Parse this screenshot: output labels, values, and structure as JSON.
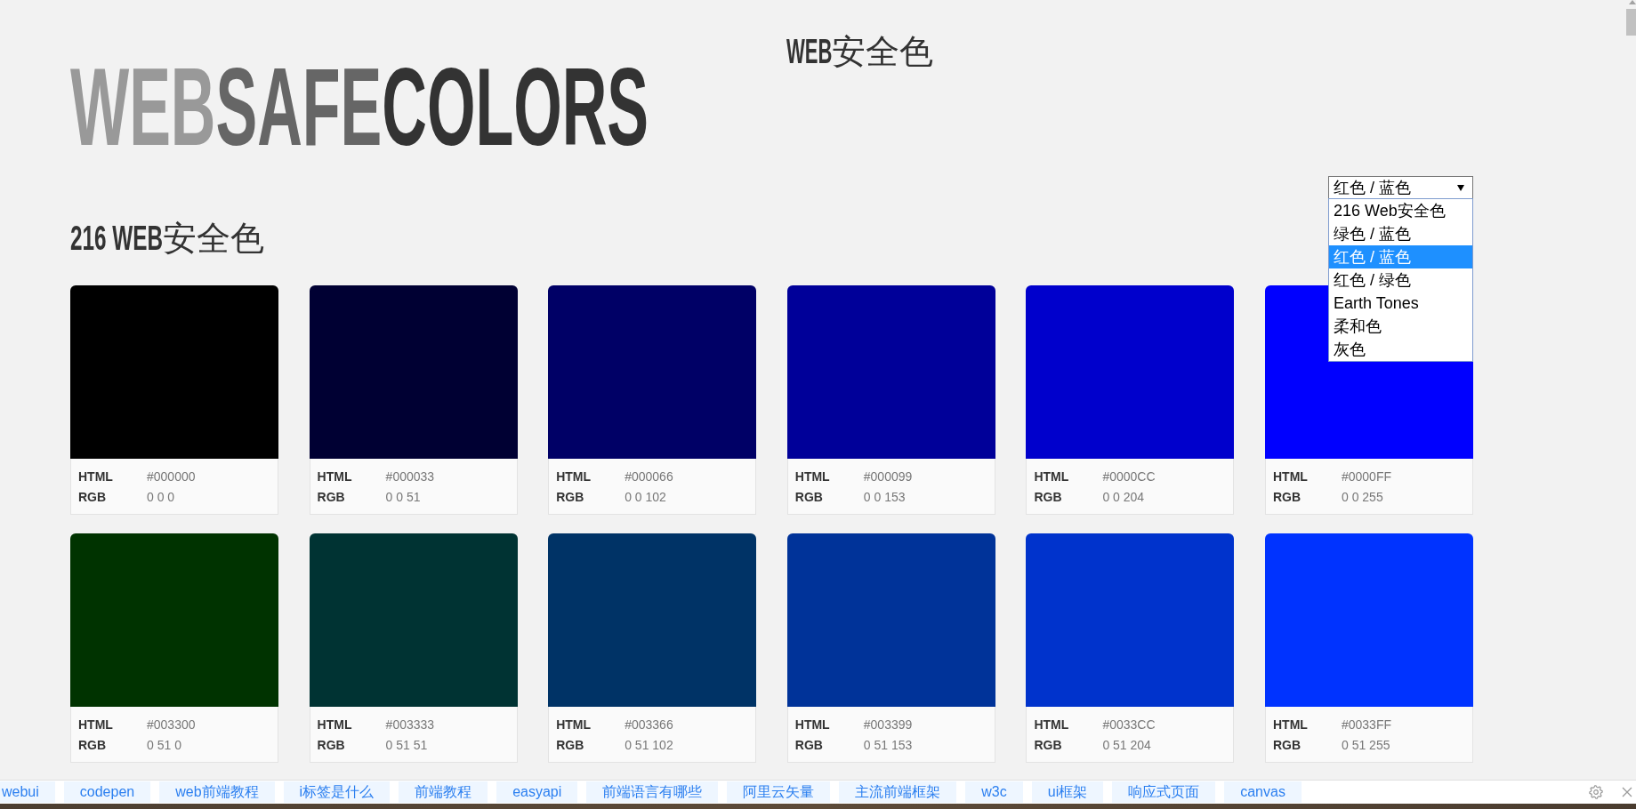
{
  "logo": {
    "parts": [
      {
        "text": "WEB",
        "color": "#999999"
      },
      {
        "text": "SAFE",
        "color": "#666666"
      },
      {
        "text": "COLORS",
        "color": "#333333"
      }
    ]
  },
  "site_title": "**WEB**安全色",
  "palette_select": {
    "value": "红色 / 蓝色",
    "expanded": true,
    "options": [
      {
        "label": "216 Web安全色",
        "selected": false
      },
      {
        "label": "绿色 / 蓝色",
        "selected": false
      },
      {
        "label": "红色 / 蓝色",
        "selected": true
      },
      {
        "label": "红色 / 绿色",
        "selected": false
      },
      {
        "label": "Earth Tones",
        "selected": false
      },
      {
        "label": "柔和色",
        "selected": false
      },
      {
        "label": "灰色",
        "selected": false
      }
    ]
  },
  "section_heading": "**216 WEB**安全色",
  "cards": [
    {
      "html_label": "HTML",
      "html": "#000000",
      "rgb_label": "RGB",
      "rgb": "0 0 0",
      "color": "#000000"
    },
    {
      "html_label": "HTML",
      "html": "#000033",
      "rgb_label": "RGB",
      "rgb": "0 0 51",
      "color": "#000033"
    },
    {
      "html_label": "HTML",
      "html": "#000066",
      "rgb_label": "RGB",
      "rgb": "0 0 102",
      "color": "#000066"
    },
    {
      "html_label": "HTML",
      "html": "#000099",
      "rgb_label": "RGB",
      "rgb": "0 0 153",
      "color": "#000099"
    },
    {
      "html_label": "HTML",
      "html": "#0000CC",
      "rgb_label": "RGB",
      "rgb": "0 0 204",
      "color": "#0000cc"
    },
    {
      "html_label": "HTML",
      "html": "#0000FF",
      "rgb_label": "RGB",
      "rgb": "0 0 255",
      "color": "#0000ff"
    },
    {
      "html_label": "HTML",
      "html": "#003300",
      "rgb_label": "RGB",
      "rgb": "0 51 0",
      "color": "#003300"
    },
    {
      "html_label": "HTML",
      "html": "#003333",
      "rgb_label": "RGB",
      "rgb": "0 51 51",
      "color": "#003333"
    },
    {
      "html_label": "HTML",
      "html": "#003366",
      "rgb_label": "RGB",
      "rgb": "0 51 102",
      "color": "#003366"
    },
    {
      "html_label": "HTML",
      "html": "#003399",
      "rgb_label": "RGB",
      "rgb": "0 51 153",
      "color": "#003399"
    },
    {
      "html_label": "HTML",
      "html": "#0033CC",
      "rgb_label": "RGB",
      "rgb": "0 51 204",
      "color": "#0033cc"
    },
    {
      "html_label": "HTML",
      "html": "#0033FF",
      "rgb_label": "RGB",
      "rgb": "0 51 255",
      "color": "#0033ff"
    }
  ],
  "bottom_bar": {
    "tags": [
      "webui",
      "codepen",
      "web前端教程",
      "i标签是什么",
      "前端教程",
      "easyapi",
      "前端语言有哪些",
      "阿里云矢量",
      "主流前端框架",
      "w3c",
      "ui框架",
      "响应式页面",
      "canvas"
    ]
  }
}
